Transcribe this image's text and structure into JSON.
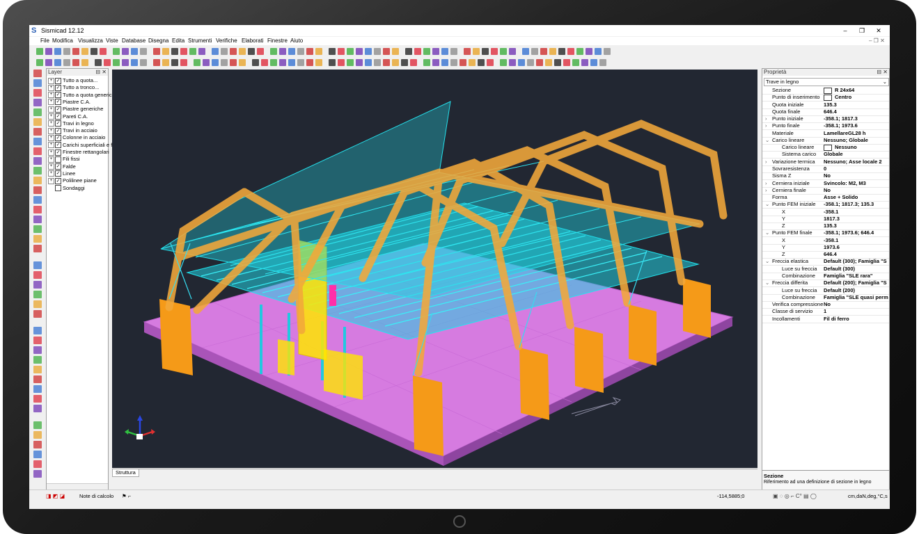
{
  "app": {
    "title": "Sismicad 12.12",
    "icon": "S"
  },
  "window_controls": {
    "minimize": "–",
    "restore": "❐",
    "close": "✕"
  },
  "menu": [
    "File",
    "Modifica",
    "Visualizza",
    "Viste",
    "Database",
    "Disegna",
    "Edita",
    "Strumenti",
    "Verifiche",
    "Elaborati",
    "Finestre",
    "Aiuto"
  ],
  "layers": {
    "header": "Layer",
    "items": [
      {
        "label": "Tutto a quota...",
        "checked": true,
        "expandable": true
      },
      {
        "label": "Tutto a tronco...",
        "checked": true,
        "expandable": true
      },
      {
        "label": "Tutto a quota generica",
        "checked": true,
        "expandable": true
      },
      {
        "label": "Piastre C.A.",
        "checked": true,
        "expandable": true
      },
      {
        "label": "Piastre generiche",
        "checked": true,
        "expandable": true
      },
      {
        "label": "Pareti C.A.",
        "checked": true,
        "expandable": true
      },
      {
        "label": "Travi in legno",
        "checked": true,
        "expandable": true
      },
      {
        "label": "Travi in acciaio",
        "checked": true,
        "expandable": true
      },
      {
        "label": "Colonne in acciaio",
        "checked": true,
        "expandable": true
      },
      {
        "label": "Carichi superficiali e fo",
        "checked": true,
        "expandable": true
      },
      {
        "label": "Finestre rettangolari",
        "checked": true,
        "expandable": true
      },
      {
        "label": "Fili fissi",
        "checked": false,
        "expandable": true
      },
      {
        "label": "Falde",
        "checked": true,
        "expandable": true
      },
      {
        "label": "Linee",
        "checked": true,
        "expandable": true
      },
      {
        "label": "Polilinee piane",
        "checked": true,
        "expandable": true
      },
      {
        "label": "Sondaggi",
        "checked": false,
        "expandable": false
      }
    ]
  },
  "viewport": {
    "tab": "Struttura"
  },
  "status": {
    "notes_label": "Note di calcolo",
    "coords": "-114,5885;0",
    "units": "cm,daN,deg,°C,s"
  },
  "properties": {
    "header": "Proprietà",
    "object_type": "Trave in legno",
    "rows": [
      {
        "k": "Sezione",
        "v": "R 24x64",
        "lvl": 0
      },
      {
        "k": "Punto di inserimento",
        "v": "Centro",
        "lvl": 0
      },
      {
        "k": "Quota iniziale",
        "v": "135.3",
        "lvl": 0
      },
      {
        "k": "Quota finale",
        "v": "646.4",
        "lvl": 0
      },
      {
        "k": "Punto iniziale",
        "v": "-358.1; 1817.3",
        "lvl": 0,
        "arrow": "›"
      },
      {
        "k": "Punto finale",
        "v": "-358.1; 1973.6",
        "lvl": 0,
        "arrow": "›"
      },
      {
        "k": "Materiale",
        "v": "LamellareGL28 h",
        "lvl": 0
      },
      {
        "k": "Carico lineare",
        "v": "Nessuno; Globale",
        "lvl": 0,
        "arrow": "⌄"
      },
      {
        "k": "Carico lineare",
        "v": "Nessuno",
        "lvl": 1
      },
      {
        "k": "Sistema carico",
        "v": "Globale",
        "lvl": 1
      },
      {
        "k": "Variazione termica",
        "v": "Nessuno; Asse locale 2",
        "lvl": 0,
        "arrow": "›"
      },
      {
        "k": "Sovraresistenza",
        "v": "0",
        "lvl": 0
      },
      {
        "k": "Sisma Z",
        "v": "No",
        "lvl": 0
      },
      {
        "k": "Cerniera iniziale",
        "v": "Svincolo: M2, M3",
        "lvl": 0,
        "arrow": "›"
      },
      {
        "k": "Cerniera finale",
        "v": "No",
        "lvl": 0,
        "arrow": "›"
      },
      {
        "k": "Forma",
        "v": "Asse + Solido",
        "lvl": 0
      },
      {
        "k": "Punto FEM iniziale",
        "v": "-358.1; 1817.3; 135.3",
        "lvl": 0,
        "arrow": "⌄"
      },
      {
        "k": "X",
        "v": "-358.1",
        "lvl": 1
      },
      {
        "k": "Y",
        "v": "1817.3",
        "lvl": 1
      },
      {
        "k": "Z",
        "v": "135.3",
        "lvl": 1
      },
      {
        "k": "Punto FEM finale",
        "v": "-358.1; 1973.6; 646.4",
        "lvl": 0,
        "arrow": "⌄"
      },
      {
        "k": "X",
        "v": "-358.1",
        "lvl": 1
      },
      {
        "k": "Y",
        "v": "1973.6",
        "lvl": 1
      },
      {
        "k": "Z",
        "v": "646.4",
        "lvl": 1
      },
      {
        "k": "Freccia elastica",
        "v": "Default (300); Famiglia \"S",
        "lvl": 0,
        "arrow": "⌄"
      },
      {
        "k": "Luce su freccia",
        "v": "Default (300)",
        "lvl": 1
      },
      {
        "k": "Combinazione",
        "v": "Famiglia \"SLE rara\"",
        "lvl": 1
      },
      {
        "k": "Freccia differita",
        "v": "Default (200); Famiglia \"S",
        "lvl": 0,
        "arrow": "⌄"
      },
      {
        "k": "Luce su freccia",
        "v": "Default (200)",
        "lvl": 1
      },
      {
        "k": "Combinazione",
        "v": "Famiglia \"SLE quasi perm",
        "lvl": 1
      },
      {
        "k": "Verifica compressione",
        "v": "No",
        "lvl": 0
      },
      {
        "k": "Classe di servizio",
        "v": "1",
        "lvl": 0
      },
      {
        "k": "Incollamenti",
        "v": "Fil di ferro",
        "lvl": 0
      }
    ],
    "desc_title": "Sezione",
    "desc_text": "Riferimento ad una definizione di sezione in legno"
  },
  "colors": {
    "viewport_bg": "#222732",
    "wood": "#f4a632",
    "steel": "#22d0e0",
    "slab": "#d67be0",
    "wall": "#ffe600"
  }
}
